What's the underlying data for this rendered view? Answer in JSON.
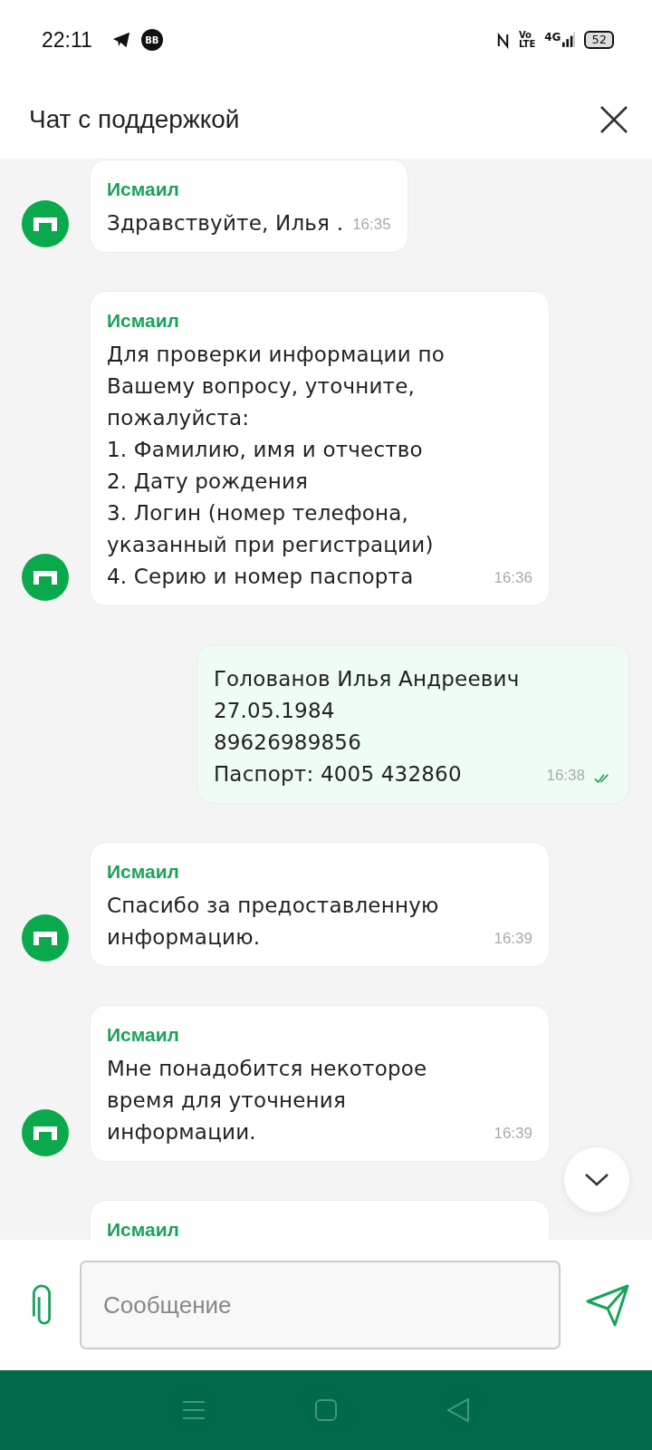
{
  "status_bar": {
    "time": "22:11",
    "notification_badge": "BB",
    "volte": [
      "Vo",
      "LTE"
    ],
    "network": "4G",
    "battery": "52"
  },
  "header": {
    "title": "Чат с поддержкой"
  },
  "messages": [
    {
      "kind": "incoming",
      "sender": "Исмаил",
      "lines": [
        "Здравствуйте, Илья ."
      ],
      "time": "16:35"
    },
    {
      "kind": "incoming",
      "sender": "Исмаил",
      "lines": [
        "Для проверки информации по",
        "Вашему вопросу, уточните,",
        "пожалуйста:",
        "1. Фамилию, имя и отчество",
        "2. Дату рождения",
        "3. Логин (номер телефона,",
        "указанный при регистрации)",
        "4. Серию и номер паспорта"
      ],
      "time": "16:36"
    },
    {
      "kind": "outgoing",
      "lines": [
        "Голованов Илья Андреевич",
        "27.05.1984",
        "89626989856",
        "Паспорт: 4005 432860"
      ],
      "time": "16:38",
      "read": true
    },
    {
      "kind": "incoming",
      "sender": "Исмаил",
      "lines": [
        "Спасибо за предоставленную",
        "информацию."
      ],
      "time": "16:39"
    },
    {
      "kind": "incoming",
      "sender": "Исмаил",
      "lines": [
        "Мне понадобится некоторое",
        "время для уточнения",
        "информации."
      ],
      "time": "16:39"
    },
    {
      "kind": "incoming",
      "sender": "Исмаил"
    }
  ],
  "composer": {
    "placeholder": "Сообщение"
  }
}
